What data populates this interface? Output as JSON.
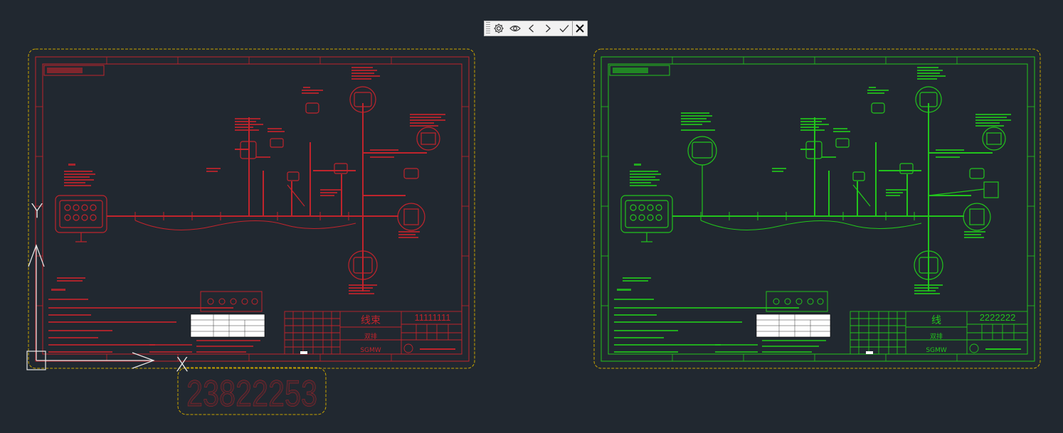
{
  "toolbar": {
    "buttons": [
      {
        "name": "settings-icon"
      },
      {
        "name": "eye-icon"
      },
      {
        "name": "previous-icon"
      },
      {
        "name": "next-icon"
      },
      {
        "name": "check-icon"
      },
      {
        "name": "close-icon"
      }
    ]
  },
  "left_drawing": {
    "color": "#c0242c",
    "title_block": {
      "title": "线束",
      "number": "11111111",
      "subtitle": "双排",
      "company": "SGMW"
    },
    "stamp_number": "23822253"
  },
  "right_drawing": {
    "color": "#22c41c",
    "title_block": {
      "title": "线",
      "number": "2222222",
      "subtitle": "双排",
      "company": "SGMW"
    }
  },
  "ucs": {
    "y_label": "Y",
    "x_label": "X"
  },
  "colors": {
    "background": "#212830",
    "border_cloud": "#c8a400",
    "left": "#c0242c",
    "right": "#22c41c"
  }
}
